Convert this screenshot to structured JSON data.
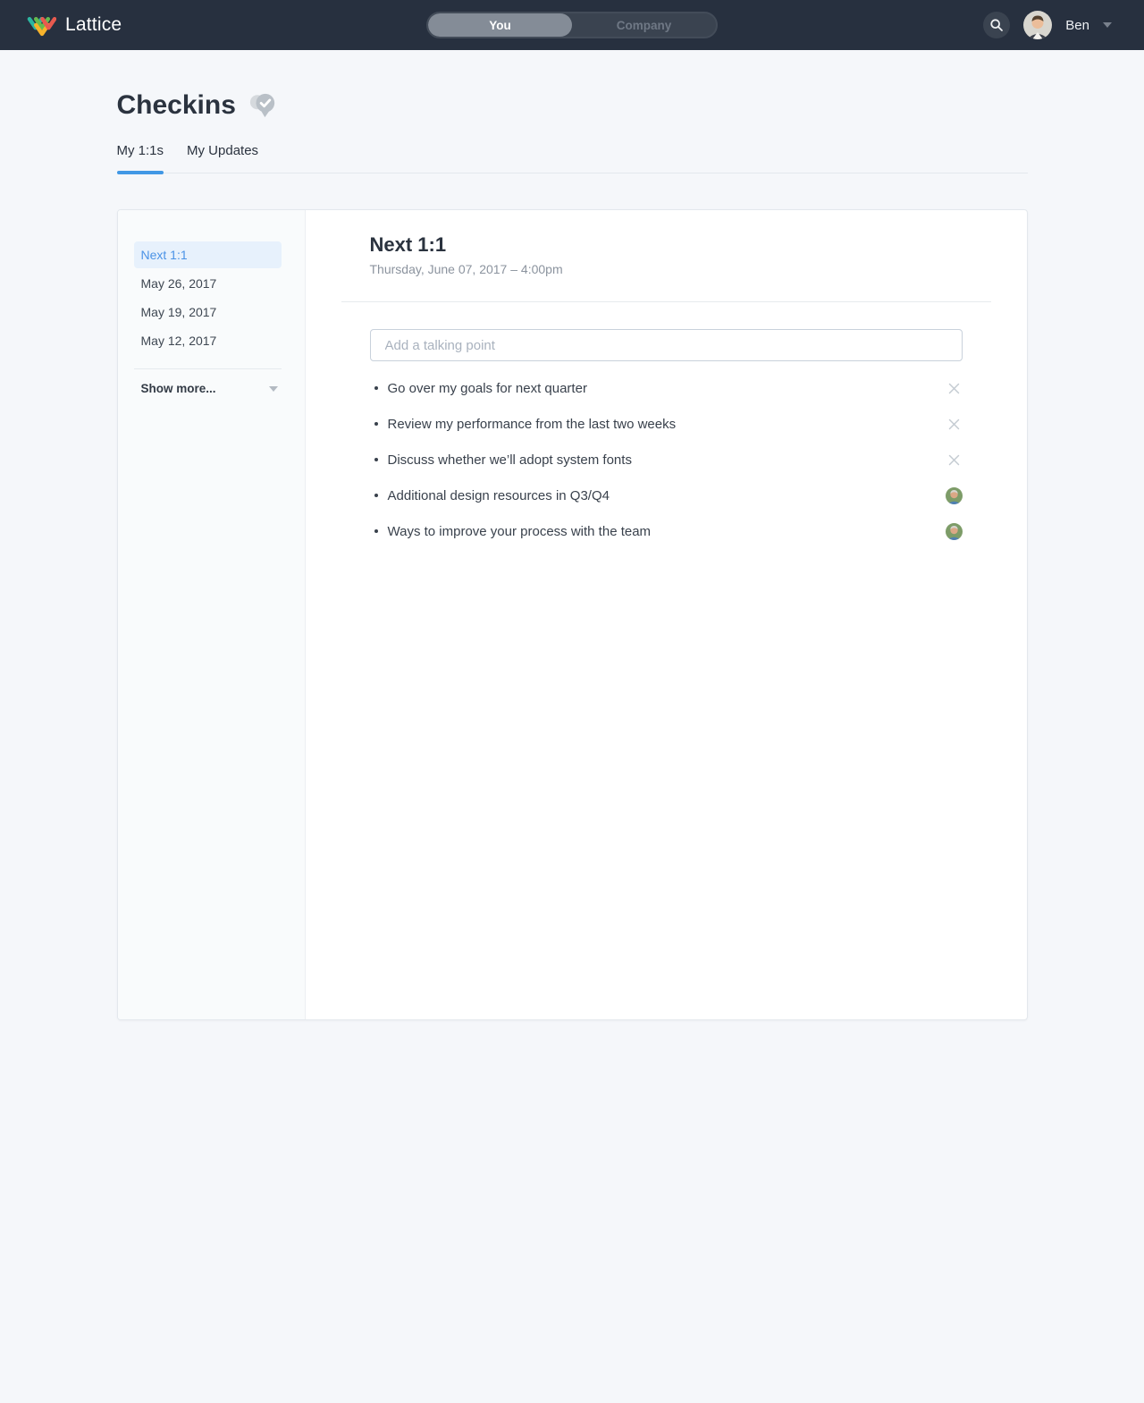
{
  "nav": {
    "brand": "Lattice",
    "toggle": {
      "you": "You",
      "company": "Company",
      "selected": "You"
    },
    "user": {
      "name": "Ben"
    }
  },
  "page": {
    "title": "Checkins",
    "tabs": [
      {
        "label": "My 1:1s",
        "active": true
      },
      {
        "label": "My Updates",
        "active": false
      }
    ]
  },
  "sidebar": {
    "items": [
      {
        "label": "Next 1:1",
        "active": true
      },
      {
        "label": "May 26, 2017",
        "active": false
      },
      {
        "label": "May 19, 2017",
        "active": false
      },
      {
        "label": "May 12, 2017",
        "active": false
      }
    ],
    "show_more_label": "Show more..."
  },
  "meeting": {
    "title": "Next 1:1",
    "datetime": "Thursday, June 07, 2017 – 4:00pm",
    "input_placeholder": "Add a talking point",
    "talking_points": [
      {
        "text": "Go over my goals for next quarter",
        "action": "remove"
      },
      {
        "text": "Review my performance from the last two weeks",
        "action": "remove"
      },
      {
        "text": "Discuss whether we’ll adopt system fonts",
        "action": "remove"
      },
      {
        "text": "Additional design resources in Q3/Q4",
        "action": "avatar"
      },
      {
        "text": "Ways to improve your process with the team",
        "action": "avatar"
      }
    ]
  },
  "colors": {
    "nav_background": "#27303f",
    "accent_blue": "#4198e5",
    "active_item_blue": "#4b93e6",
    "active_item_background": "#e7f1fc",
    "logo_teal": "#2cb5a0",
    "logo_green": "#66bb4e",
    "logo_yellow": "#f7b32b",
    "logo_red": "#e85a4f"
  }
}
